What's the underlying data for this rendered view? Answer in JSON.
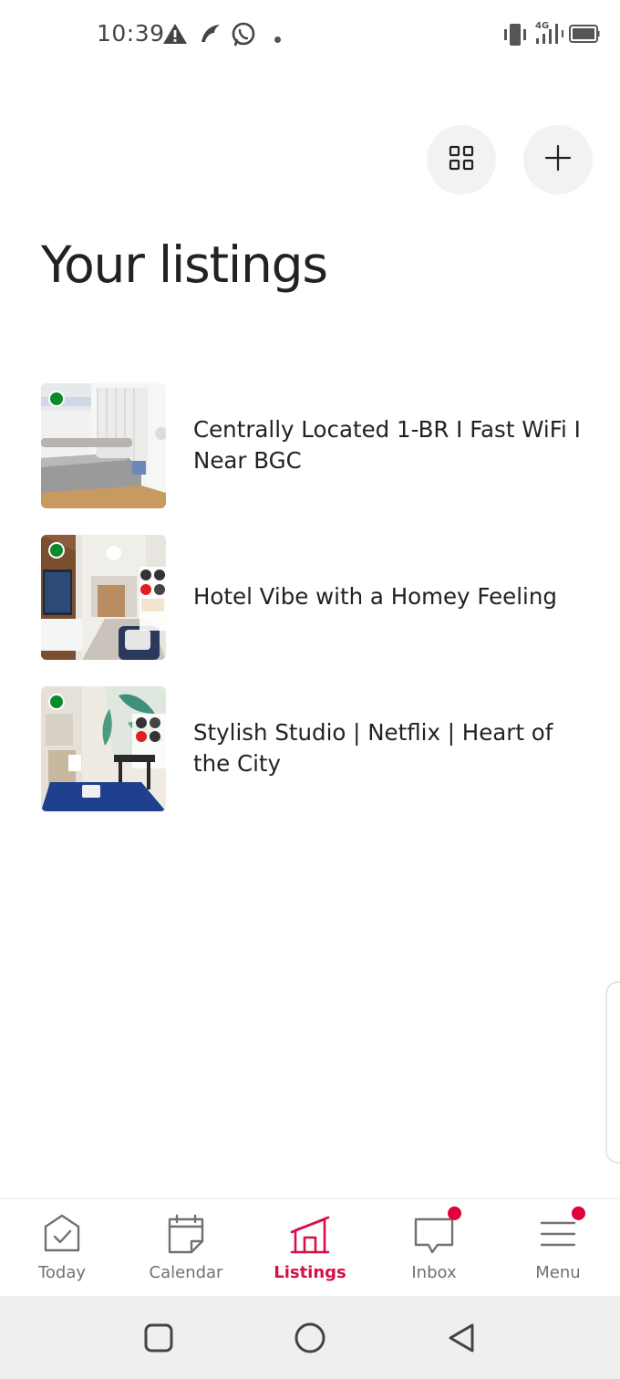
{
  "status_bar": {
    "time": "10:39",
    "icons_left": [
      "warning-icon",
      "bird-app-icon",
      "whatsapp-icon",
      "dot-icon"
    ],
    "icons_right": [
      "vibrate-icon",
      "signal-4g-icon",
      "battery-icon"
    ],
    "network_label": "4G"
  },
  "header": {
    "grid_button_icon": "grid-icon",
    "add_button_icon": "plus-icon",
    "title": "Your listings"
  },
  "listings": [
    {
      "title": "Centrally Located 1-BR I Fast WiFi I Near BGC",
      "status": "active",
      "status_color": "#0a8a2a"
    },
    {
      "title": "Hotel Vibe with a Homey Feeling",
      "status": "active",
      "status_color": "#0a8a2a"
    },
    {
      "title": "Stylish Studio | Netflix | Heart of the City",
      "status": "active",
      "status_color": "#0a8a2a"
    }
  ],
  "bottom_nav": {
    "items": [
      {
        "label": "Today",
        "icon": "today-icon",
        "active": false,
        "badge": false
      },
      {
        "label": "Calendar",
        "icon": "calendar-icon",
        "active": false,
        "badge": false
      },
      {
        "label": "Listings",
        "icon": "listings-icon",
        "active": true,
        "badge": false
      },
      {
        "label": "Inbox",
        "icon": "inbox-icon",
        "active": false,
        "badge": true
      },
      {
        "label": "Menu",
        "icon": "menu-icon",
        "active": false,
        "badge": true
      }
    ],
    "active_color": "#d70f46",
    "inactive_color": "#717171",
    "badge_color": "#e0003a"
  },
  "system_nav": {
    "buttons": [
      "recents-icon",
      "home-icon",
      "back-icon"
    ]
  }
}
